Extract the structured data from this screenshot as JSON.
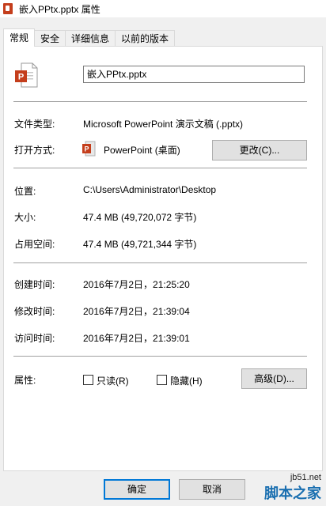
{
  "window": {
    "title": "嵌入PPtx.pptx 属性"
  },
  "tabs": [
    {
      "label": "常规"
    },
    {
      "label": "安全"
    },
    {
      "label": "详细信息"
    },
    {
      "label": "以前的版本"
    }
  ],
  "general": {
    "file_name": "嵌入PPtx.pptx",
    "file_type_label": "文件类型:",
    "file_type_value": "Microsoft PowerPoint 演示文稿 (.pptx)",
    "open_with_label": "打开方式:",
    "open_with_value": "PowerPoint (桌面)",
    "change_button": "更改(C)...",
    "location_label": "位置:",
    "location_value": "C:\\Users\\Administrator\\Desktop",
    "size_label": "大小:",
    "size_value": "47.4 MB (49,720,072 字节)",
    "size_on_disk_label": "占用空间:",
    "size_on_disk_value": "47.4 MB (49,721,344 字节)",
    "created_label": "创建时间:",
    "created_value": "2016年7月2日，21:25:20",
    "modified_label": "修改时间:",
    "modified_value": "2016年7月2日，21:39:04",
    "accessed_label": "访问时间:",
    "accessed_value": "2016年7月2日，21:39:01",
    "attributes_label": "属性:",
    "readonly_label": "只读(R)",
    "readonly_checked": false,
    "hidden_label": "隐藏(H)",
    "hidden_checked": false,
    "advanced_button": "高级(D)..."
  },
  "footer": {
    "ok_button": "确定",
    "cancel_button": "取消"
  },
  "watermark": {
    "url": "jb51.net",
    "logo": "脚本之家"
  },
  "icons": {
    "title_icon": "powerpoint-icon",
    "file_icon": "powerpoint-file-icon",
    "open_with_icon": "powerpoint-app-icon"
  },
  "colors": {
    "powerpoint_accent": "#c43e1c",
    "focus_border": "#0078d7"
  }
}
